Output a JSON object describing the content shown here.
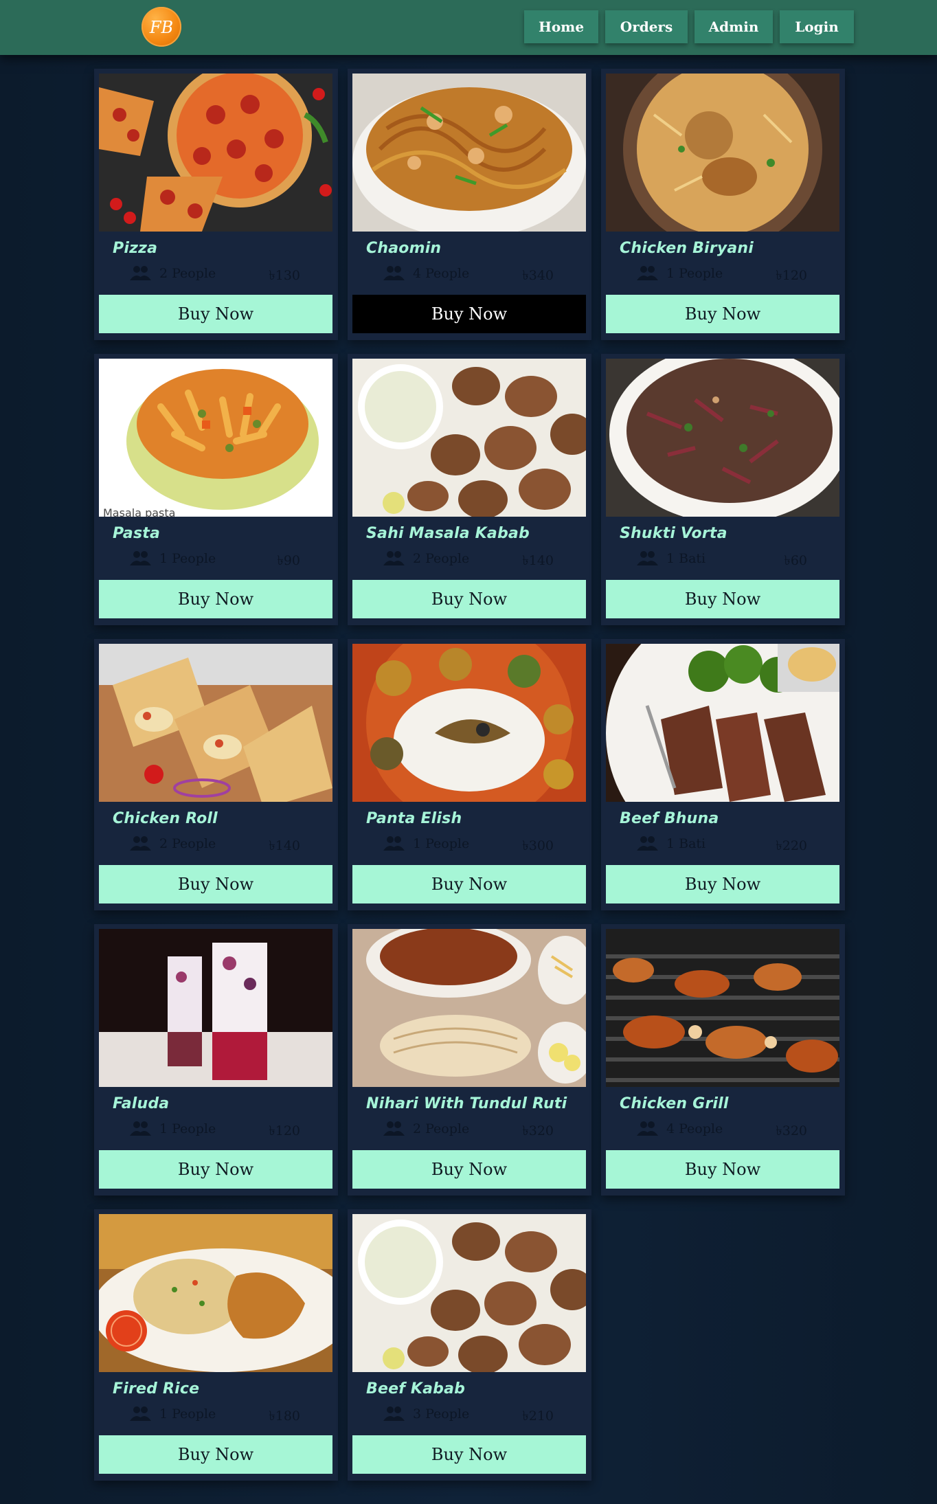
{
  "nav": {
    "logo_text": "FB",
    "links": [
      "Home",
      "Orders",
      "Admin",
      "Login"
    ]
  },
  "colors": {
    "navbar": "#2c6b58",
    "nav_button": "#32826b",
    "card": "#17253d",
    "title": "#a6f4d8",
    "buy_button": "#a6f6d6",
    "buy_button_hover": "#000000"
  },
  "buy_label": "Buy Now",
  "items": [
    {
      "name": "Pizza",
      "serves": "2 People",
      "price": "৳130"
    },
    {
      "name": "Chaomin",
      "serves": "4 People",
      "price": "৳340"
    },
    {
      "name": "Chicken Biryani",
      "serves": "1 People",
      "price": "৳120"
    },
    {
      "name": "Pasta",
      "serves": "1 People",
      "price": "৳90",
      "image_caption": "Masala pasta"
    },
    {
      "name": "Sahi Masala Kabab",
      "serves": "2 People",
      "price": "৳140"
    },
    {
      "name": "Shukti Vorta",
      "serves": "1 Bati",
      "price": "৳60"
    },
    {
      "name": "Chicken Roll",
      "serves": "2 People",
      "price": "৳140"
    },
    {
      "name": "Panta Elish",
      "serves": "1 People",
      "price": "৳300"
    },
    {
      "name": "Beef Bhuna",
      "serves": "1 Bati",
      "price": "৳220"
    },
    {
      "name": "Faluda",
      "serves": "1 People",
      "price": "৳120"
    },
    {
      "name": "Nihari With Tundul Ruti",
      "serves": "2 People",
      "price": "৳320"
    },
    {
      "name": "Chicken Grill",
      "serves": "4 People",
      "price": "৳320"
    },
    {
      "name": "Fired Rice",
      "serves": "1 People",
      "price": "৳180"
    },
    {
      "name": "Beef Kabab",
      "serves": "3 People",
      "price": "৳210"
    }
  ]
}
